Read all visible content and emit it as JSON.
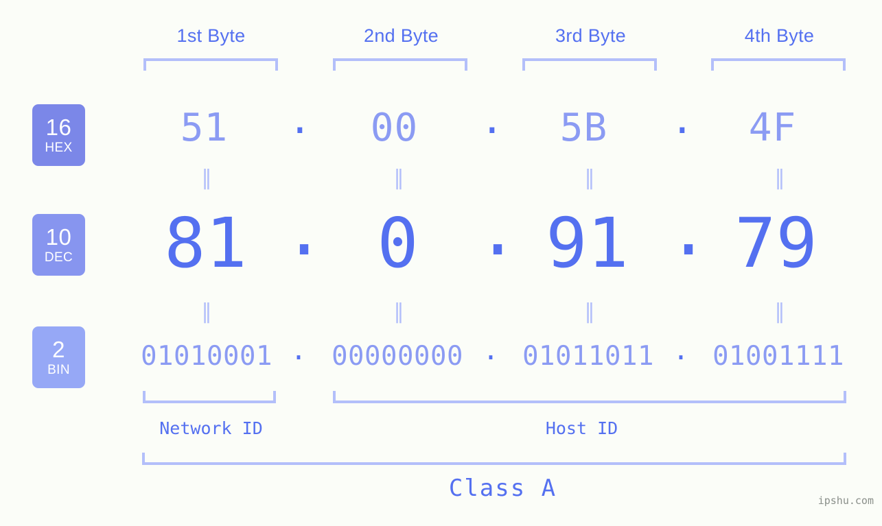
{
  "background_color": "#fbfdf8",
  "accent_color": "#5470f0",
  "accent_light_color": "#8b9bf3",
  "bracket_color": "#b3bffa",
  "headers": [
    {
      "label": "1st Byte"
    },
    {
      "label": "2nd Byte"
    },
    {
      "label": "3rd Byte"
    },
    {
      "label": "4th Byte"
    }
  ],
  "bases": [
    {
      "number": "16",
      "name": "HEX",
      "color": "#7b87e8"
    },
    {
      "number": "10",
      "name": "DEC",
      "color": "#8795ef"
    },
    {
      "number": "2",
      "name": "BIN",
      "color": "#96a8f6"
    }
  ],
  "separator": ".",
  "equals_glyph": "‖",
  "rows": {
    "hex": {
      "values": [
        "51",
        "00",
        "5B",
        "4F"
      ]
    },
    "dec": {
      "values": [
        "81",
        "0",
        "91",
        "79"
      ]
    },
    "bin": {
      "values": [
        "01010001",
        "00000000",
        "01011011",
        "01001111"
      ]
    }
  },
  "segments": {
    "network_id": "Network ID",
    "host_id": "Host ID",
    "class": "Class A"
  },
  "watermark": "ipshu.com"
}
